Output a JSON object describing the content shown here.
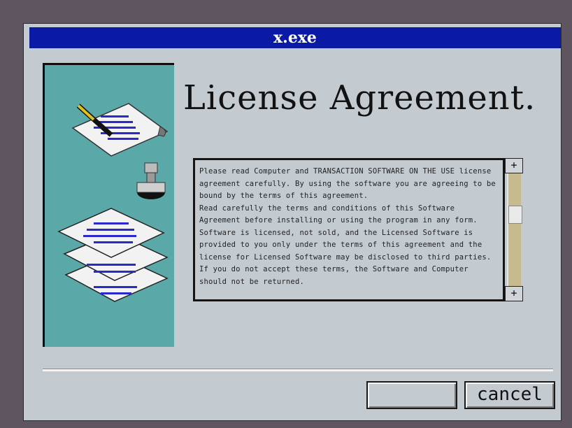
{
  "window": {
    "title": "x.exe",
    "heading": "License Agreement.",
    "license_paragraphs": [
      "Please read Computer and TRANSACTION SOFTWARE ON THE USE license agreement carefully. By using the software you are agreeing to be bound by the terms of this agreement.",
      "Read carefully the terms and conditions of this Software Agreement before installing or using the program in any form. Software is licensed, not sold, and the Licensed Software is provided to you only under the terms of this agreement and the license for Licensed Software may be disclosed to third parties. If you do not accept these terms, the Software and Computer should not be returned."
    ],
    "scroll_up": "+",
    "scroll_down": "+",
    "buttons": {
      "accept_label": "",
      "cancel_label": "cancel"
    },
    "colors": {
      "titlebar": "#0a1aa4",
      "sidebar": "#5aa8a8",
      "window": "#c4cbd0",
      "desktop": "#5e5560"
    },
    "illustration_icons": [
      "quill-pen-icon",
      "document-icon",
      "ink-bottle-icon",
      "document-stack-icon"
    ]
  }
}
